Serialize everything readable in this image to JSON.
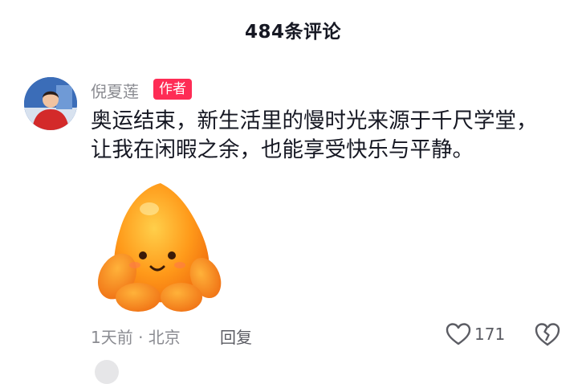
{
  "header": {
    "title": "484条评论"
  },
  "comment": {
    "author": "倪夏莲",
    "badge": "作者",
    "text": "奥运结束，新生活里的慢时光来源于千尺学堂，让我在闲暇之余，也能享受快乐与平静。",
    "meta": "1天前 · 北京",
    "reply_label": "回复",
    "like_count": "171"
  },
  "colors": {
    "badge": "#fe2c55",
    "muted": "#8a8b91",
    "sticker": "#ff9a1a"
  },
  "icons": {
    "like": "heart-outline-icon",
    "dislike": "broken-heart-icon"
  }
}
